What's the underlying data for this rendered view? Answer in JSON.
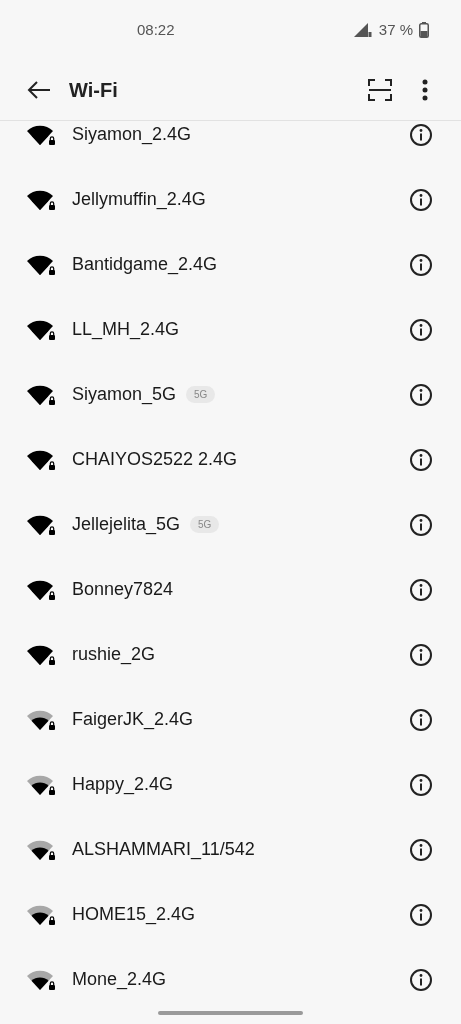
{
  "status_bar": {
    "time": "08:22",
    "battery": "37 %"
  },
  "header": {
    "title": "Wi-Fi"
  },
  "networks": [
    {
      "name": "Siyamon_2.4G",
      "kind": "full"
    },
    {
      "name": "Jellymuffin_2.4G",
      "kind": "full"
    },
    {
      "name": "Bantidgame_2.4G",
      "kind": "full"
    },
    {
      "name": "LL_MH_2.4G",
      "kind": "full"
    },
    {
      "name": "Siyamon_5G",
      "kind": "full",
      "band": "5G"
    },
    {
      "name": "CHAIYOS2522 2.4G",
      "kind": "full"
    },
    {
      "name": "Jellejelita_5G",
      "kind": "full",
      "band": "5G"
    },
    {
      "name": "Bonney7824",
      "kind": "full"
    },
    {
      "name": "rushie_2G",
      "kind": "full"
    },
    {
      "name": "FaigerJK_2.4G",
      "kind": "partial"
    },
    {
      "name": "Happy_2.4G",
      "kind": "partial"
    },
    {
      "name": "ALSHAMMARI_11/542",
      "kind": "partial"
    },
    {
      "name": "HOME15_2.4G",
      "kind": "partial"
    },
    {
      "name": "Mone_2.4G",
      "kind": "partial"
    }
  ]
}
